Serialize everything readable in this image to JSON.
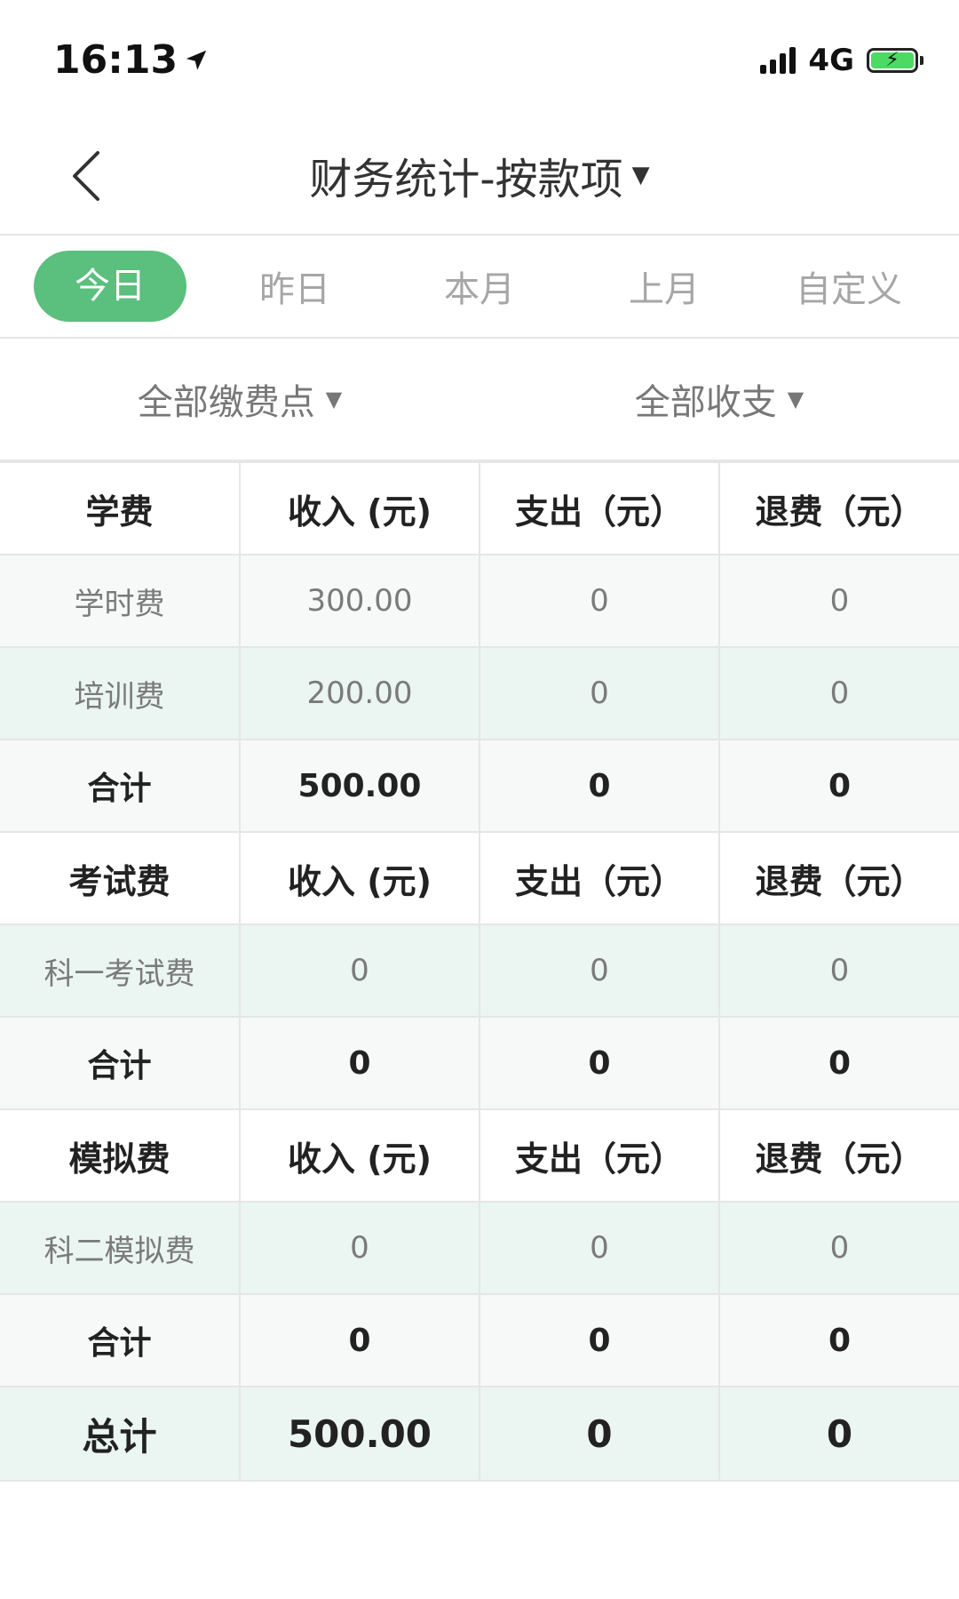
{
  "status_bar": {
    "time": "16:13",
    "network": "4G"
  },
  "nav": {
    "title": "财务统计-按款项"
  },
  "period_tabs": [
    {
      "label": "今日",
      "active": true
    },
    {
      "label": "昨日",
      "active": false
    },
    {
      "label": "本月",
      "active": false
    },
    {
      "label": "上月",
      "active": false
    },
    {
      "label": "自定义",
      "active": false
    }
  ],
  "filters": {
    "location": "全部缴费点",
    "type": "全部收支"
  },
  "columns": {
    "income": "收入 (元)",
    "expense": "支出（元）",
    "refund": "退费（元）"
  },
  "sections": [
    {
      "name": "学费",
      "items": [
        {
          "name": "学时费",
          "income": "300.00",
          "expense": "0",
          "refund": "0"
        },
        {
          "name": "培训费",
          "income": "200.00",
          "expense": "0",
          "refund": "0"
        }
      ],
      "subtotal": {
        "label": "合计",
        "income": "500.00",
        "expense": "0",
        "refund": "0"
      }
    },
    {
      "name": "考试费",
      "items": [
        {
          "name": "科一考试费",
          "income": "0",
          "expense": "0",
          "refund": "0"
        }
      ],
      "subtotal": {
        "label": "合计",
        "income": "0",
        "expense": "0",
        "refund": "0"
      }
    },
    {
      "name": "模拟费",
      "items": [
        {
          "name": "科二模拟费",
          "income": "0",
          "expense": "0",
          "refund": "0"
        }
      ],
      "subtotal": {
        "label": "合计",
        "income": "0",
        "expense": "0",
        "refund": "0"
      }
    }
  ],
  "grand_total": {
    "label": "总计",
    "income": "500.00",
    "expense": "0",
    "refund": "0"
  },
  "colors": {
    "accent": "#5bbf7e",
    "row_light": "#f6f9f8",
    "row_tint": "#ebf5f2"
  }
}
